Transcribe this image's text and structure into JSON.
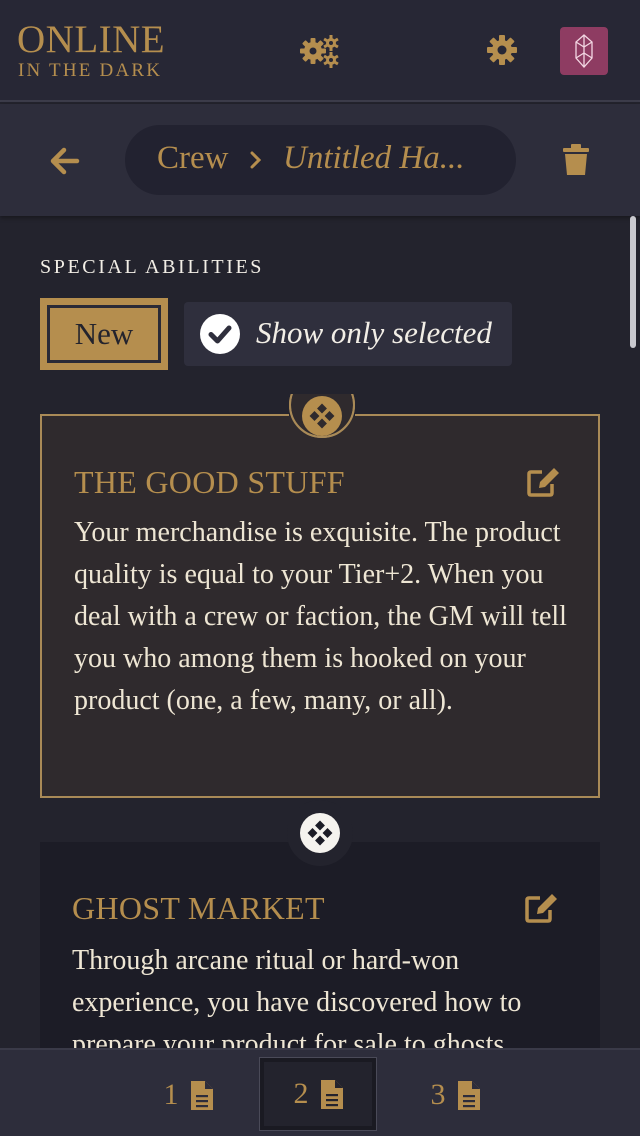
{
  "header": {
    "logo_title": "ONLINE",
    "logo_subtitle": "IN THE DARK"
  },
  "icons": {
    "gears": "gears-icon",
    "settings": "gear-icon",
    "avatar": "crystal-icon",
    "back": "arrow-left-icon",
    "separator": "chevron-right-icon",
    "delete": "trash-icon",
    "check": "check-circle-icon",
    "edit": "edit-icon",
    "badge": "diamond-cluster-icon",
    "page": "file-icon"
  },
  "colors": {
    "accent": "#b58e4e",
    "avatar_bg": "#8e3c62",
    "background": "#23232d",
    "selected_card_bg": "#2f2a2d"
  },
  "nav": {
    "breadcrumb_root": "Crew",
    "breadcrumb_current": "Untitled Ha..."
  },
  "abilities": {
    "section_title": "SPECIAL ABILITIES",
    "new_label": "New",
    "toggle_label": "Show only selected",
    "toggle_checked": true,
    "items": [
      {
        "title": "THE GOOD STUFF",
        "selected": true,
        "text": "Your merchandise is exquisite. The product quality is equal to your Tier+2. When you deal with a crew or faction, the GM will tell you who among them is hooked on your product (one, a few, many, or all)."
      },
      {
        "title": "GHOST MARKET",
        "selected": false,
        "text": "Through arcane ritual or hard-won experience, you have discovered how to prepare your product for sale to ghosts"
      }
    ]
  },
  "pages": {
    "tabs": [
      {
        "label": "1",
        "active": false
      },
      {
        "label": "2",
        "active": true
      },
      {
        "label": "3",
        "active": false
      }
    ]
  }
}
